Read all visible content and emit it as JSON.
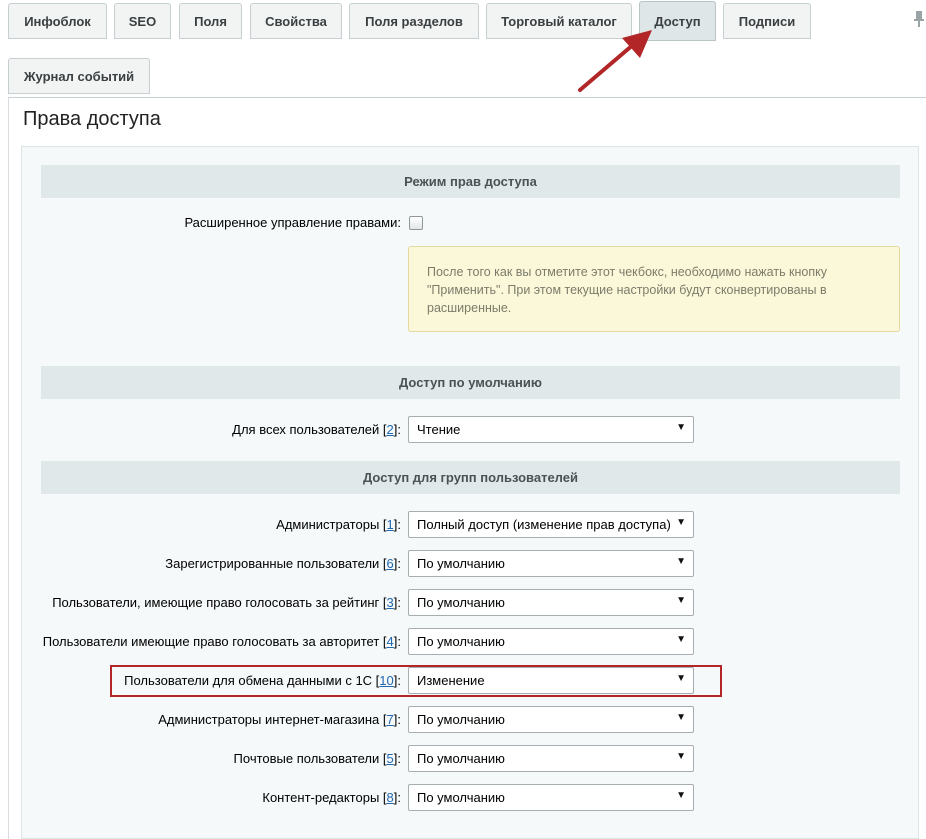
{
  "tabs_row1": [
    {
      "label": "Инфоблок",
      "active": false
    },
    {
      "label": "SEO",
      "active": false
    },
    {
      "label": "Поля",
      "active": false
    },
    {
      "label": "Свойства",
      "active": false
    },
    {
      "label": "Поля разделов",
      "active": false
    },
    {
      "label": "Торговый каталог",
      "active": false
    },
    {
      "label": "Доступ",
      "active": true
    },
    {
      "label": "Подписи",
      "active": false
    }
  ],
  "tabs_row2": [
    {
      "label": "Журнал событий",
      "active": false
    }
  ],
  "page_title": "Права доступа",
  "sections": {
    "mode": {
      "title": "Режим прав доступа",
      "extended_label": "Расширенное управление правами:",
      "extended_checked": false,
      "hint": "После того как вы отметите этот чекбокс, необходимо нажать кнопку \"Применить\". При этом текущие настройки будут сконвертированы в расширенные."
    },
    "default": {
      "title": "Доступ по умолчанию",
      "row": {
        "label": "Для всех пользователей",
        "count": "2",
        "value": "Чтение"
      }
    },
    "groups": {
      "title": "Доступ для групп пользователей",
      "rows": [
        {
          "label": "Администраторы",
          "count": "1",
          "value": "Полный доступ (изменение прав доступа)"
        },
        {
          "label": "Зарегистрированные пользователи",
          "count": "6",
          "value": "По умолчанию"
        },
        {
          "label": "Пользователи, имеющие право голосовать за рейтинг",
          "count": "3",
          "value": "По умолчанию"
        },
        {
          "label": "Пользователи имеющие право голосовать за авторитет",
          "count": "4",
          "value": "По умолчанию"
        },
        {
          "label": "Пользователи для обмена данными с 1С",
          "count": "10",
          "value": "Изменение"
        },
        {
          "label": "Администраторы интернет-магазина",
          "count": "7",
          "value": "По умолчанию"
        },
        {
          "label": "Почтовые пользователи",
          "count": "5",
          "value": "По умолчанию"
        },
        {
          "label": "Контент-редакторы",
          "count": "8",
          "value": "По умолчанию"
        }
      ]
    }
  },
  "colors": {
    "annotation_red": "#b22628",
    "link_blue": "#2067b0"
  },
  "icons": {
    "pin": "pin-icon",
    "arrow": "dropdown-arrow-icon"
  }
}
